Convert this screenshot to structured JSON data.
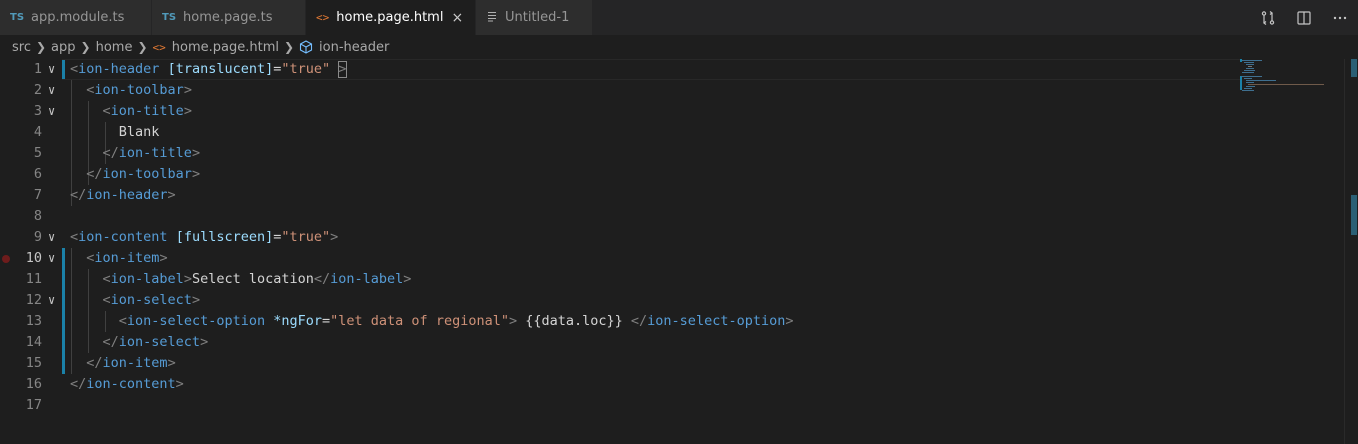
{
  "tabs": [
    {
      "icon": "TS",
      "label": "app.module.ts",
      "active": false
    },
    {
      "icon": "TS",
      "label": "home.page.ts",
      "active": false
    },
    {
      "icon": "<>",
      "label": "home.page.html",
      "active": true,
      "close": "×"
    },
    {
      "icon": "file",
      "label": "Untitled-1",
      "active": false
    }
  ],
  "breadcrumb": {
    "items": [
      "src",
      "app",
      "home",
      "home.page.html",
      "ion-header"
    ]
  },
  "editor": {
    "line_numbers": [
      "1",
      "2",
      "3",
      "4",
      "5",
      "6",
      "7",
      "8",
      "9",
      "10",
      "11",
      "12",
      "13",
      "14",
      "15",
      "16",
      "17"
    ],
    "active_line": "10",
    "breakpoint_line": "10"
  },
  "colors": {
    "tag": "#569cd6",
    "attribute": "#9cdcfe",
    "string": "#ce9178",
    "bracket": "#808080",
    "text": "#d4d4d4",
    "html_icon": "#e37933",
    "ts_icon": "#519aba"
  },
  "icons": {
    "compare": "source-control-compare-icon",
    "split": "split-editor-icon",
    "more": "more-actions-icon"
  }
}
